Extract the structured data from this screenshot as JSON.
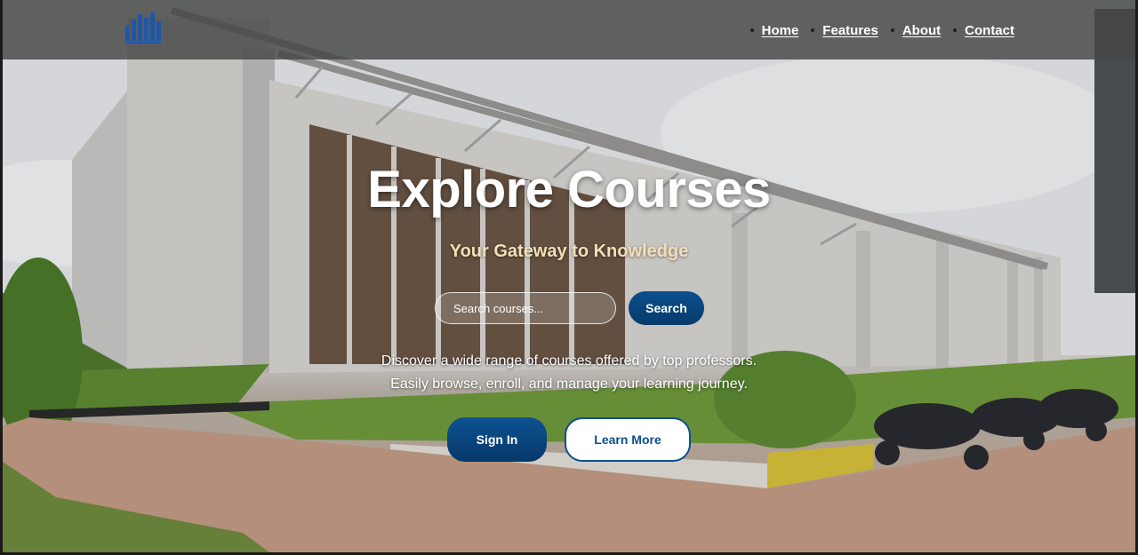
{
  "nav": {
    "logo_icon": "institute-logo-icon",
    "links": [
      {
        "label": "Home"
      },
      {
        "label": "Features"
      },
      {
        "label": "About"
      },
      {
        "label": "Contact"
      }
    ]
  },
  "hero": {
    "title": "Explore Courses",
    "subtitle": "Your Gateway to Knowledge",
    "search": {
      "placeholder": "Search courses...",
      "button_label": "Search"
    },
    "description_line1": "Discover a wide range of courses offered by top professors.",
    "description_line2": "Easily browse, enroll, and manage your learning journey.",
    "sign_in_label": "Sign In",
    "learn_more_label": "Learn More"
  },
  "colors": {
    "primary": "#0b4f8e",
    "subtitle": "#f3dfb6",
    "navbar": "#464646"
  }
}
